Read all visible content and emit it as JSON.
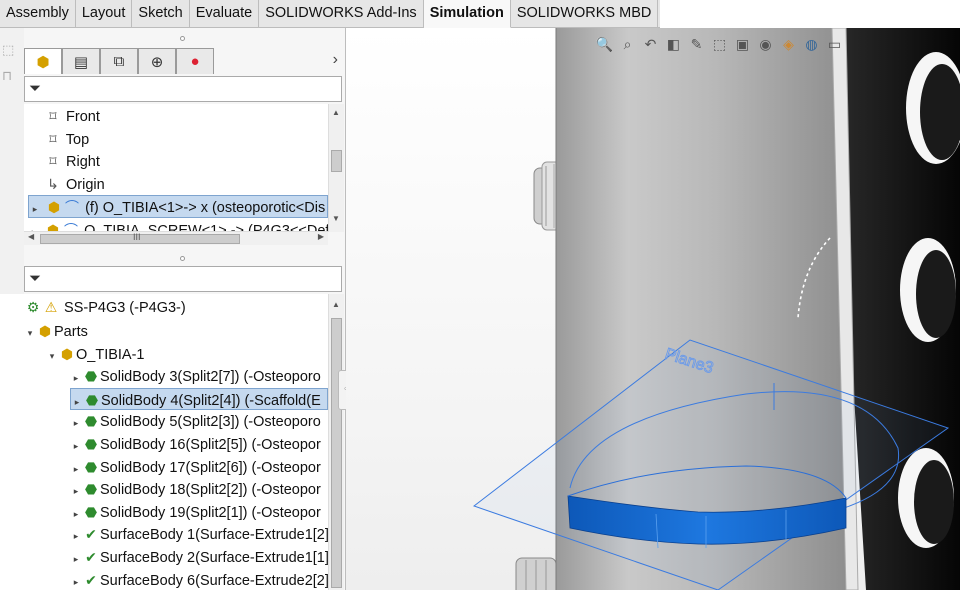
{
  "tabs": [
    {
      "label": "Assembly",
      "active": false
    },
    {
      "label": "Layout",
      "active": false
    },
    {
      "label": "Sketch",
      "active": false
    },
    {
      "label": "Evaluate",
      "active": false
    },
    {
      "label": "SOLIDWORKS Add-Ins",
      "active": false
    },
    {
      "label": "Simulation",
      "active": true
    },
    {
      "label": "SOLIDWORKS MBD",
      "active": false
    }
  ],
  "feature_manager": {
    "tab_icons": [
      "part-icon",
      "property-manager-icon",
      "configuration-manager-icon",
      "dimxpert-icon",
      "display-manager-icon"
    ],
    "more_glyph": "›",
    "tree": [
      {
        "label": "Front",
        "icon": "plane-icon",
        "arrow": ""
      },
      {
        "label": "Top",
        "icon": "plane-icon",
        "arrow": ""
      },
      {
        "label": "Right",
        "icon": "plane-icon",
        "arrow": ""
      },
      {
        "label": "Origin",
        "icon": "origin-icon",
        "arrow": ""
      },
      {
        "label": "(f) O_TIBIA<1>-> x (osteoporotic<Dis",
        "icon": "component-icon",
        "arrow": "▸",
        "selected": true
      },
      {
        "label": "O_TIBIA_SCREW<1> -> (P4G3<<Def",
        "icon": "component-icon",
        "arrow": "▸"
      }
    ],
    "hscroll_glyph": "III"
  },
  "simulation_tree": {
    "root": {
      "label": "SS-P4G3 (-P4G3-)"
    },
    "rows": [
      {
        "label": "Parts",
        "icon": "parts-icon",
        "arrow": "▾",
        "indent": 1
      },
      {
        "label": "O_TIBIA-1",
        "icon": "part-icon",
        "arrow": "▾",
        "indent": 2
      },
      {
        "label": "SolidBody 3(Split2[7]) (-Osteoporo",
        "icon": "solid-body-icon",
        "arrow": "▸",
        "indent": 3
      },
      {
        "label": "SolidBody 4(Split2[4]) (-Scaffold(E",
        "icon": "solid-body-icon",
        "arrow": "▸",
        "indent": 3,
        "selected": true
      },
      {
        "label": "SolidBody 5(Split2[3]) (-Osteoporo",
        "icon": "solid-body-icon",
        "arrow": "▸",
        "indent": 3
      },
      {
        "label": "SolidBody 16(Split2[5]) (-Osteopor",
        "icon": "solid-body-icon",
        "arrow": "▸",
        "indent": 3
      },
      {
        "label": "SolidBody 17(Split2[6]) (-Osteopor",
        "icon": "solid-body-icon",
        "arrow": "▸",
        "indent": 3
      },
      {
        "label": "SolidBody 18(Split2[2]) (-Osteopor",
        "icon": "solid-body-icon",
        "arrow": "▸",
        "indent": 3
      },
      {
        "label": "SolidBody 19(Split2[1]) (-Osteopor",
        "icon": "solid-body-icon",
        "arrow": "▸",
        "indent": 3
      },
      {
        "label": "SurfaceBody 1(Surface-Extrude1[2]",
        "icon": "surface-body-icon",
        "arrow": "▸",
        "indent": 3
      },
      {
        "label": "SurfaceBody 2(Surface-Extrude1[1]",
        "icon": "surface-body-icon",
        "arrow": "▸",
        "indent": 3
      },
      {
        "label": "SurfaceBody 6(Surface-Extrude2[2]",
        "icon": "surface-body-icon",
        "arrow": "▸",
        "indent": 3
      }
    ]
  },
  "viewport": {
    "plane_label": "Plane3",
    "heads_up_icons": [
      "zoom-to-fit-icon",
      "zoom-area-icon",
      "previous-view-icon",
      "section-view-icon",
      "dynamic-annotation-icon",
      "view-orientation-icon",
      "display-style-icon",
      "hide-show-icon",
      "edit-appearance-icon",
      "apply-scene-icon",
      "view-settings-icon"
    ],
    "colors": {
      "cylinder": "#b5b5b5",
      "band": "#1a6ed1",
      "plane_outline": "#3b7be0"
    }
  }
}
